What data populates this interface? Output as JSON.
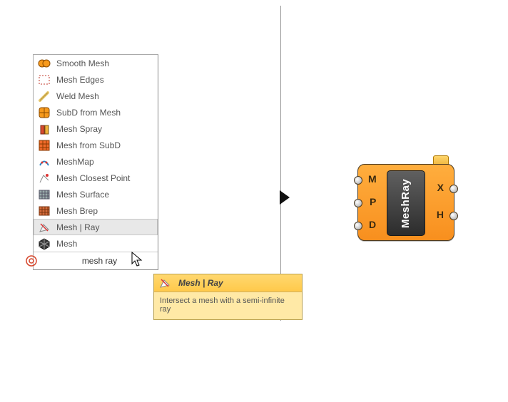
{
  "menu": {
    "items": [
      {
        "icon": "smooth-mesh-icon",
        "label": "Smooth Mesh"
      },
      {
        "icon": "mesh-edges-icon",
        "label": "Mesh Edges"
      },
      {
        "icon": "weld-mesh-icon",
        "label": "Weld Mesh"
      },
      {
        "icon": "subd-from-mesh-icon",
        "label": "SubD from Mesh"
      },
      {
        "icon": "mesh-spray-icon",
        "label": "Mesh Spray"
      },
      {
        "icon": "mesh-from-subd-icon",
        "label": "Mesh from SubD"
      },
      {
        "icon": "meshmap-icon",
        "label": "MeshMap"
      },
      {
        "icon": "mesh-closest-point-icon",
        "label": "Mesh Closest Point"
      },
      {
        "icon": "mesh-surface-icon",
        "label": "Mesh Surface"
      },
      {
        "icon": "mesh-brep-icon",
        "label": "Mesh Brep"
      },
      {
        "icon": "mesh-ray-icon",
        "label": "Mesh | Ray"
      },
      {
        "icon": "mesh-icon",
        "label": "Mesh"
      }
    ],
    "selected_index": 10,
    "search_value": "mesh ray"
  },
  "tooltip": {
    "title": "Mesh | Ray",
    "body": "Intersect a mesh with a semi-infinite ray"
  },
  "node": {
    "label": "MeshRay",
    "inputs": [
      "M",
      "P",
      "D"
    ],
    "outputs": [
      "X",
      "H"
    ]
  }
}
